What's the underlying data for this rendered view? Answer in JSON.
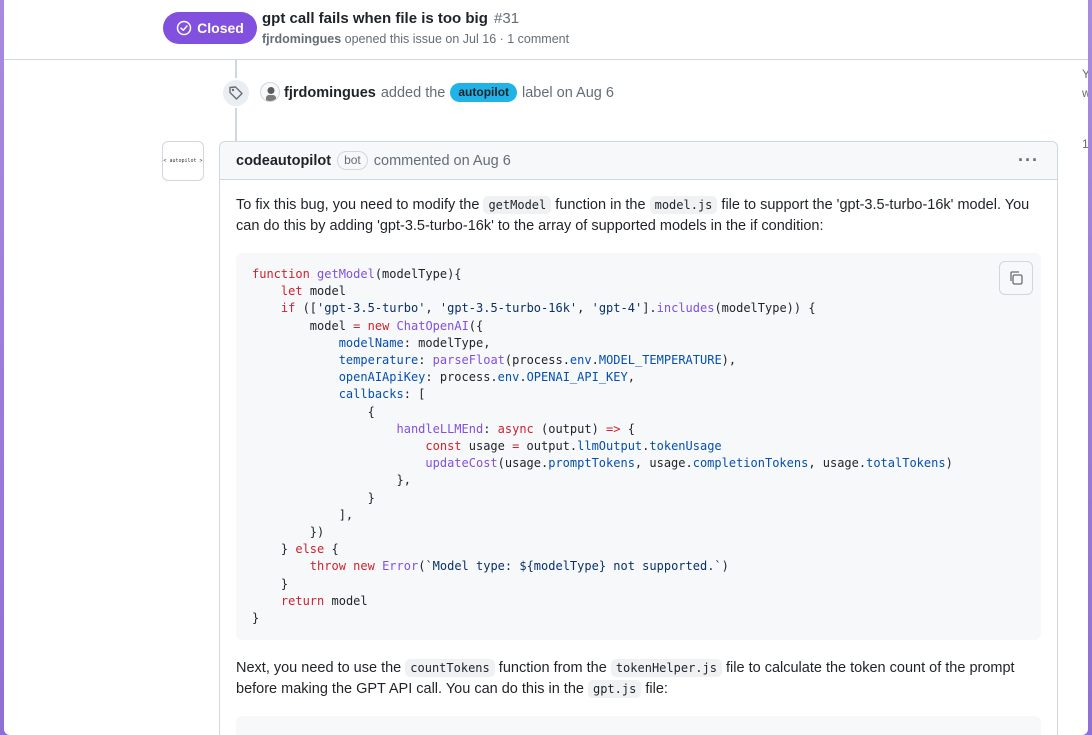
{
  "header": {
    "state_label": "Closed",
    "title": "gpt call fails when file is too big",
    "number": "#31",
    "author": "fjrdomingues",
    "meta_suffix": "opened this issue on Jul 16 · 1 comment"
  },
  "event": {
    "actor": "fjrdomingues",
    "action": "added the",
    "label": "autopilot",
    "suffix": "label on Aug 6",
    "label_color": "#1fb3e8"
  },
  "comment": {
    "avatar_text": "< autopilot >",
    "author": "codeautopilot",
    "badge": "bot",
    "meta": "commented on Aug 6",
    "menu": "···",
    "para1": {
      "a": "To fix this bug, you need to modify the ",
      "code1": "getModel",
      "b": " function in the ",
      "code2": "model.js",
      "c": " file to support the 'gpt-3.5-turbo-16k' model. You can do this by adding 'gpt-3.5-turbo-16k' to the array of supported models in the if condition:"
    },
    "para2": {
      "a": "Next, you need to use the ",
      "code1": "countTokens",
      "b": " function from the ",
      "code2": "tokenHelper.js",
      "c": " file to calculate the token count of the prompt before making the GPT API call. You can do this in the ",
      "code3": "gpt.js",
      "d": " file:"
    }
  },
  "right_sidebar": [
    "Y",
    "w",
    "1"
  ],
  "colors": {
    "closed_purple": "#8250df",
    "background_gradient": "#a98ae0"
  }
}
